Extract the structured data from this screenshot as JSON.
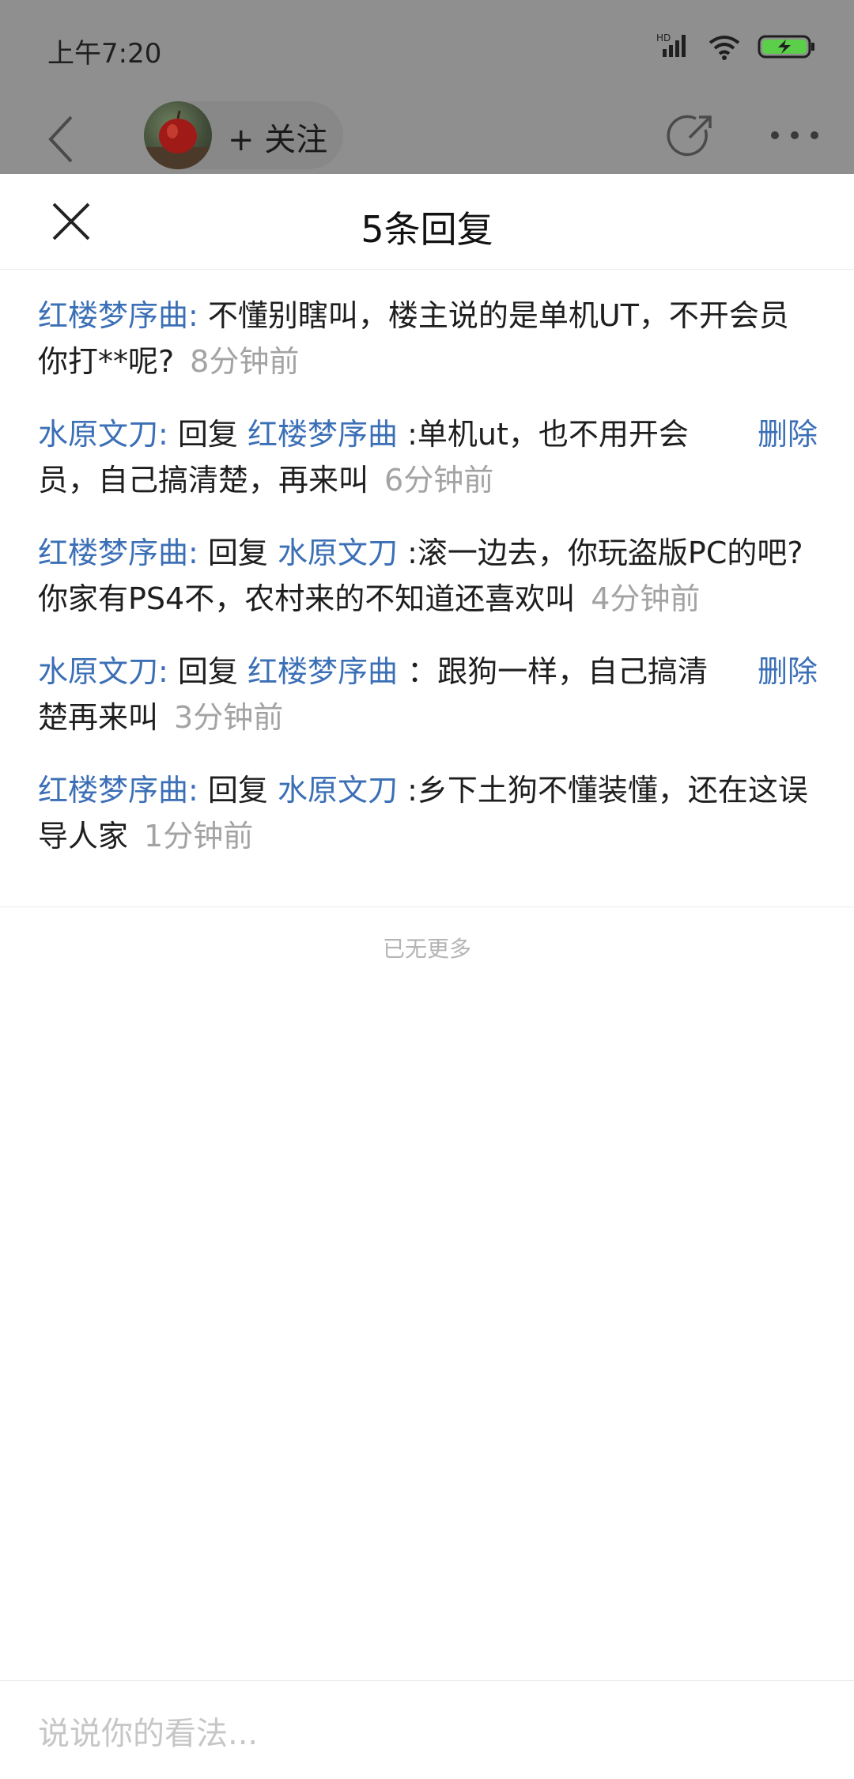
{
  "status_bar": {
    "time": "上午7:20",
    "icons": [
      "hd-signal-icon",
      "wifi-icon",
      "battery-charging-icon"
    ],
    "hd_label": "HD"
  },
  "top_nav": {
    "follow_label": "+ 关注"
  },
  "sheet": {
    "title": "5条回复"
  },
  "replies": [
    {
      "author": "红楼梦序曲:",
      "prefix": "",
      "mention": "",
      "content": "不懂别瞎叫，楼主说的是单机UT，不开会员你打**呢?",
      "time": "8分钟前",
      "delete": ""
    },
    {
      "author": "水原文刀:",
      "prefix": "回复",
      "mention": "红楼梦序曲",
      "content": ":单机ut，也不用开会员，自己搞清楚，再来叫",
      "time": "6分钟前",
      "delete": "删除"
    },
    {
      "author": "红楼梦序曲:",
      "prefix": "回复",
      "mention": "水原文刀",
      "content": ":滚一边去，你玩盗版PC的吧? 你家有PS4不，农村来的不知道还喜欢叫",
      "time": "4分钟前",
      "delete": ""
    },
    {
      "author": "水原文刀:",
      "prefix": "回复",
      "mention": "红楼梦序曲",
      "content": "：跟狗一样，自己搞清楚再来叫",
      "time": "3分钟前",
      "delete": "删除"
    },
    {
      "author": "红楼梦序曲:",
      "prefix": "回复",
      "mention": "水原文刀",
      "content": ":乡下土狗不懂装懂，还在这误导人家",
      "time": "1分钟前",
      "delete": ""
    }
  ],
  "footer": {
    "no_more": "已无更多",
    "input_placeholder": "说说你的看法..."
  },
  "colors": {
    "link_blue": "#3b6fb6",
    "dim_overlay": "#8f8f8f",
    "time_gray": "#a3a3a3",
    "battery_green": "#5ccf4a"
  }
}
